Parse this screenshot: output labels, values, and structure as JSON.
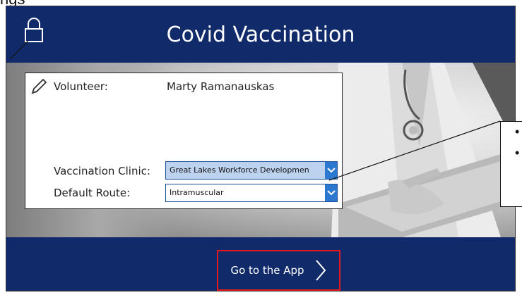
{
  "header": {
    "title": "Covid Vaccination"
  },
  "page_top_text": "ngs",
  "volunteer": {
    "label": "Volunteer:",
    "name": "Marty  Ramanauskas"
  },
  "vaccination_clinic": {
    "label": "Vaccination Clinic:",
    "selected": "Great Lakes Workforce Developmen"
  },
  "default_route": {
    "label": "Default Route:",
    "selected": "Intramuscular"
  },
  "callout": {
    "bullets": [
      "•",
      "•"
    ]
  },
  "footer": {
    "go_button_label": "Go to the App"
  },
  "colors": {
    "header_bg": "#112a6a",
    "dropdown_accent": "#2a78cf",
    "highlight_fill": "#bcd2ee",
    "button_border": "#e21a1a"
  },
  "icons": [
    "lock-icon",
    "pencil-icon",
    "chevron-down-icon",
    "chevron-right-icon"
  ]
}
